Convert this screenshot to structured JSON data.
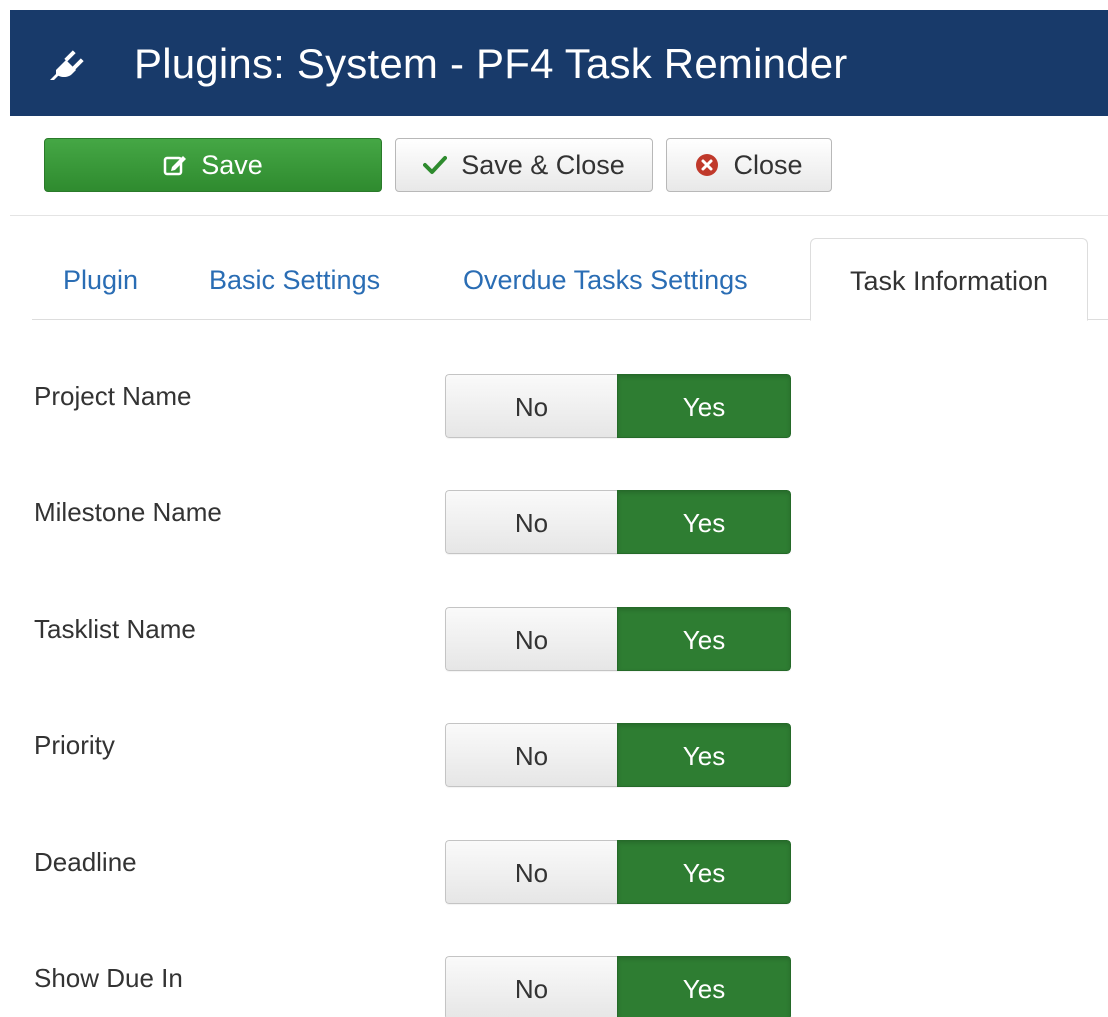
{
  "header": {
    "title": "Plugins: System - PF4 Task Reminder",
    "icon": "plug-icon",
    "background_color": "#183a6a"
  },
  "toolbar": {
    "save_label": "Save",
    "save_close_label": "Save & Close",
    "close_label": "Close",
    "save_icon": "edit-icon",
    "save_close_icon": "check-icon",
    "close_icon": "close-circle-icon",
    "save_color": "#3a9a3a"
  },
  "tabs": [
    {
      "label": "Plugin",
      "active": false
    },
    {
      "label": "Basic Settings",
      "active": false
    },
    {
      "label": "Overdue Tasks Settings",
      "active": false
    },
    {
      "label": "Task Information",
      "active": true
    }
  ],
  "toggle_labels": {
    "no": "No",
    "yes": "Yes"
  },
  "fields": [
    {
      "label": "Project Name",
      "value": "Yes"
    },
    {
      "label": "Milestone Name",
      "value": "Yes"
    },
    {
      "label": "Tasklist Name",
      "value": "Yes"
    },
    {
      "label": "Priority",
      "value": "Yes"
    },
    {
      "label": "Deadline",
      "value": "Yes"
    },
    {
      "label": "Show Due In",
      "value": "Yes"
    }
  ],
  "colors": {
    "yes_active": "#2e7d32",
    "link": "#2a6db4",
    "close_icon": "#c0392b"
  }
}
